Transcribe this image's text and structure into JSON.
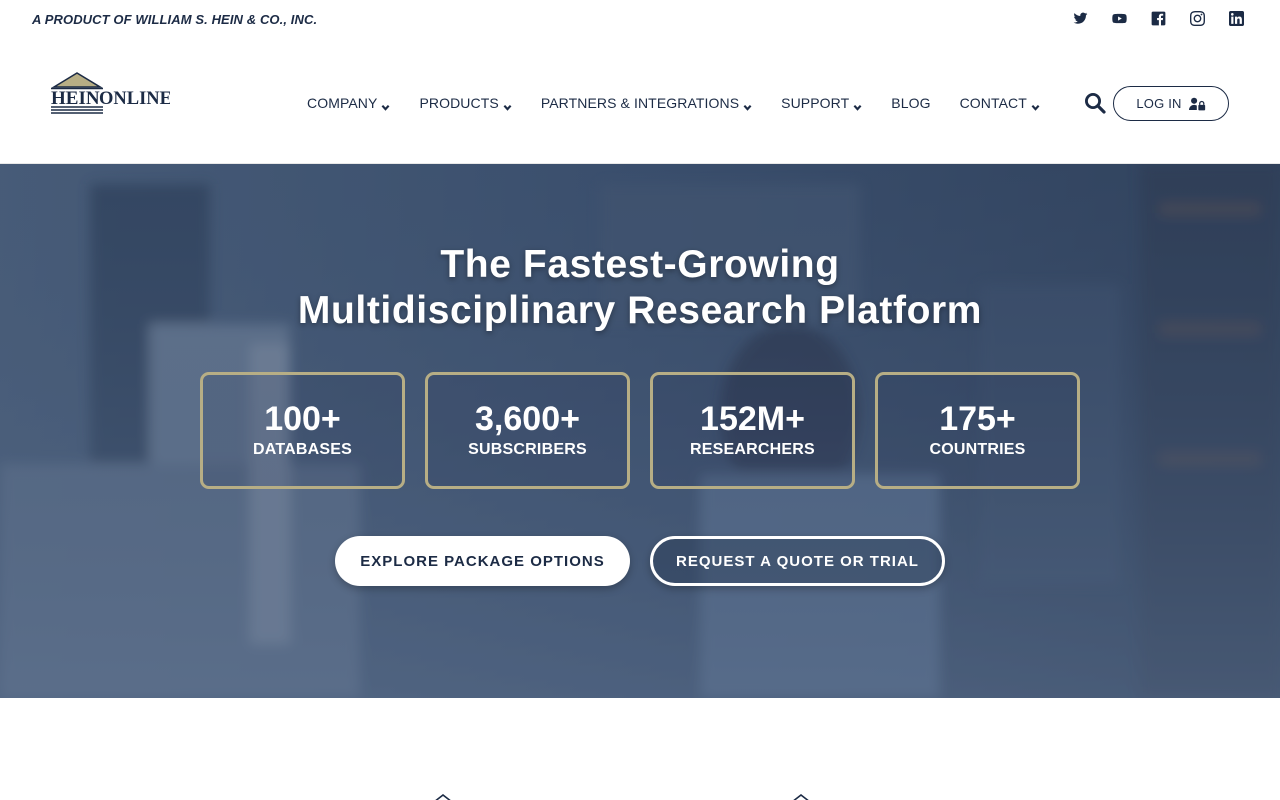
{
  "topbar": {
    "tagline": "A PRODUCT OF WILLIAM S. HEIN & CO., INC.",
    "social": [
      "twitter-icon",
      "youtube-icon",
      "facebook-icon",
      "instagram-icon",
      "linkedin-icon"
    ]
  },
  "header": {
    "logo_text": {
      "part1": "HEIN",
      "part2": "ONLINE"
    },
    "nav": [
      {
        "label": "COMPANY",
        "has_dropdown": true
      },
      {
        "label": "PRODUCTS",
        "has_dropdown": true
      },
      {
        "label": "PARTNERS & INTEGRATIONS",
        "has_dropdown": true
      },
      {
        "label": "SUPPORT",
        "has_dropdown": true
      },
      {
        "label": "BLOG",
        "has_dropdown": false
      },
      {
        "label": "CONTACT",
        "has_dropdown": true
      }
    ],
    "login_label": "LOG IN"
  },
  "hero": {
    "title_line1": "The Fastest-Growing",
    "title_line2": "Multidisciplinary Research Platform",
    "stats": [
      {
        "number": "100+",
        "label": "DATABASES"
      },
      {
        "number": "3,600+",
        "label": "SUBSCRIBERS"
      },
      {
        "number": "152M+",
        "label": "RESEARCHERS"
      },
      {
        "number": "175+",
        "label": "COUNTRIES"
      }
    ],
    "primary_cta": "EXPLORE PACKAGE OPTIONS",
    "secondary_cta": "REQUEST A QUOTE OR TRIAL"
  },
  "colors": {
    "navy": "#1c2b45",
    "gold": "#b7ae85",
    "hero_overlay": "#4a5d78"
  }
}
